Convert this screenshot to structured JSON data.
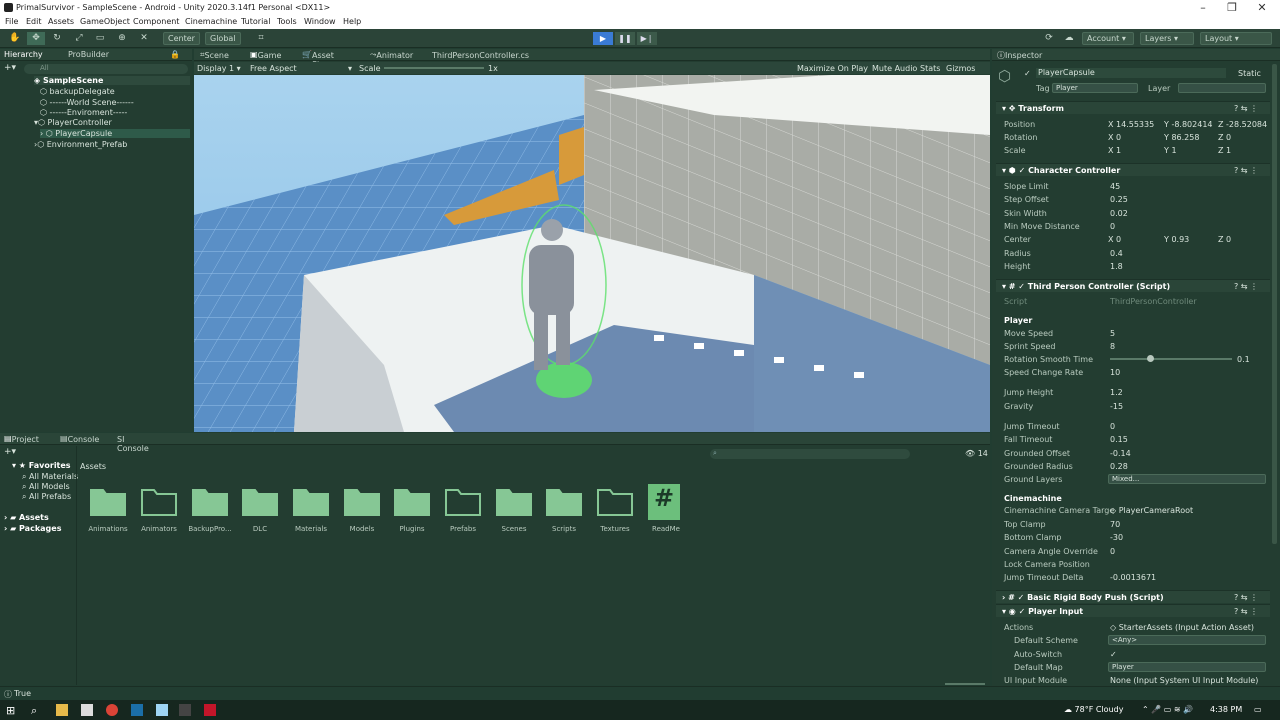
{
  "window": {
    "title": "PrimalSurvivor - SampleScene - Android - Unity 2020.3.14f1 Personal <DX11>"
  },
  "menu": [
    "File",
    "Edit",
    "Assets",
    "GameObject",
    "Component",
    "Cinemachine",
    "Tutorial",
    "Tools",
    "Window",
    "Help"
  ],
  "toolbar": {
    "center": "Center",
    "global": "Global",
    "account": "Account",
    "layers": "Layers",
    "layout": "Layout"
  },
  "hierarchy": {
    "tabs": [
      "Hierarchy",
      "ProBuilder"
    ],
    "search_placeholder": "All",
    "items": [
      "SampleScene",
      "backupDelegate",
      "------World Scene------",
      "------Enviroment-----",
      "PlayerController",
      "PlayerCapsule",
      "Environment_Prefab"
    ]
  },
  "view": {
    "tabs": [
      "Scene",
      "Game",
      "Asset Store",
      "Animator",
      "ThirdPersonController.cs"
    ],
    "display": "Display 1",
    "aspect": "Free Aspect",
    "scale_label": "Scale",
    "scale_value": "1x",
    "options": [
      "Maximize On Play",
      "Mute Audio",
      "Stats",
      "Gizmos"
    ]
  },
  "project": {
    "tabs": [
      "Project",
      "Console",
      "SI Console"
    ],
    "favorites_label": "Favorites",
    "favorites": [
      "All Materials",
      "All Models",
      "All Prefabs"
    ],
    "roots": [
      "Assets",
      "Packages"
    ],
    "breadcrumb": "Assets",
    "count": "14",
    "folders": [
      "Animations",
      "Animators",
      "BackupPro...",
      "DLC",
      "Materials",
      "Models",
      "Plugins",
      "Prefabs",
      "Scenes",
      "Scripts",
      "Textures",
      "ReadMe"
    ]
  },
  "inspector": {
    "tab": "Inspector",
    "object_name": "PlayerCapsule",
    "static_label": "Static",
    "tag_label": "Tag",
    "tag": "Player",
    "layer_label": "Layer",
    "transform": {
      "title": "Transform",
      "position": {
        "label": "Position",
        "x": "14.55335",
        "y": "-8.802414",
        "z": "-28.52084"
      },
      "rotation": {
        "label": "Rotation",
        "x": "0",
        "y": "86.258",
        "z": "0"
      },
      "scale": {
        "label": "Scale",
        "x": "1",
        "y": "1",
        "z": "1"
      }
    },
    "cc": {
      "title": "Character Controller",
      "rows": [
        [
          "Slope Limit",
          "45"
        ],
        [
          "Step Offset",
          "0.25"
        ],
        [
          "Skin Width",
          "0.02"
        ],
        [
          "Min Move Distance",
          "0"
        ]
      ],
      "center": {
        "label": "Center",
        "x": "0",
        "y": "0.93",
        "z": "0"
      },
      "rows2": [
        [
          "Radius",
          "0.4"
        ],
        [
          "Height",
          "1.8"
        ]
      ]
    },
    "tpc": {
      "title": "Third Person Controller (Script)",
      "script_label": "Script",
      "script": "ThirdPersonController",
      "player_header": "Player",
      "rows": [
        [
          "Move Speed",
          "5"
        ],
        [
          "Sprint Speed",
          "8"
        ],
        [
          "Rotation Smooth Time",
          "0.1"
        ],
        [
          "Speed Change Rate",
          "10"
        ],
        [
          "Jump Height",
          "1.2"
        ],
        [
          "Gravity",
          "-15"
        ],
        [
          "Jump Timeout",
          "0"
        ],
        [
          "Fall Timeout",
          "0.15"
        ],
        [
          "Grounded Offset",
          "-0.14"
        ],
        [
          "Grounded Radius",
          "0.28"
        ]
      ],
      "ground_layers_label": "Ground Layers",
      "ground_layers": "Mixed...",
      "cine_header": "Cinemachine",
      "cine_target_label": "Cinemachine Camera Targe",
      "cine_target": "PlayerCameraRoot",
      "rows2": [
        [
          "Top Clamp",
          "70"
        ],
        [
          "Bottom Clamp",
          "-30"
        ],
        [
          "Camera Angle Override",
          "0"
        ],
        [
          "Lock Camera Position",
          ""
        ],
        [
          "Jump Timeout Delta",
          "-0.0013671"
        ]
      ]
    },
    "brbp": {
      "title": "Basic Rigid Body Push (Script)"
    },
    "pi": {
      "title": "Player Input",
      "actions_label": "Actions",
      "actions": "StarterAssets (Input Action Asset)",
      "scheme_label": "Default Scheme",
      "scheme": "<Any>",
      "auto_label": "Auto-Switch",
      "auto": "✓",
      "map_label": "Default Map",
      "map": "Player",
      "ui_label": "UI Input Module",
      "ui": "None (Input System UI Input Module)"
    }
  },
  "status": {
    "text": "True"
  },
  "taskbar": {
    "weather": "78°F  Cloudy",
    "time": "4:38 PM"
  },
  "colors": {
    "accent": "#3a7bd5",
    "panel": "#233d31",
    "green_capsule": "#5de06a"
  }
}
